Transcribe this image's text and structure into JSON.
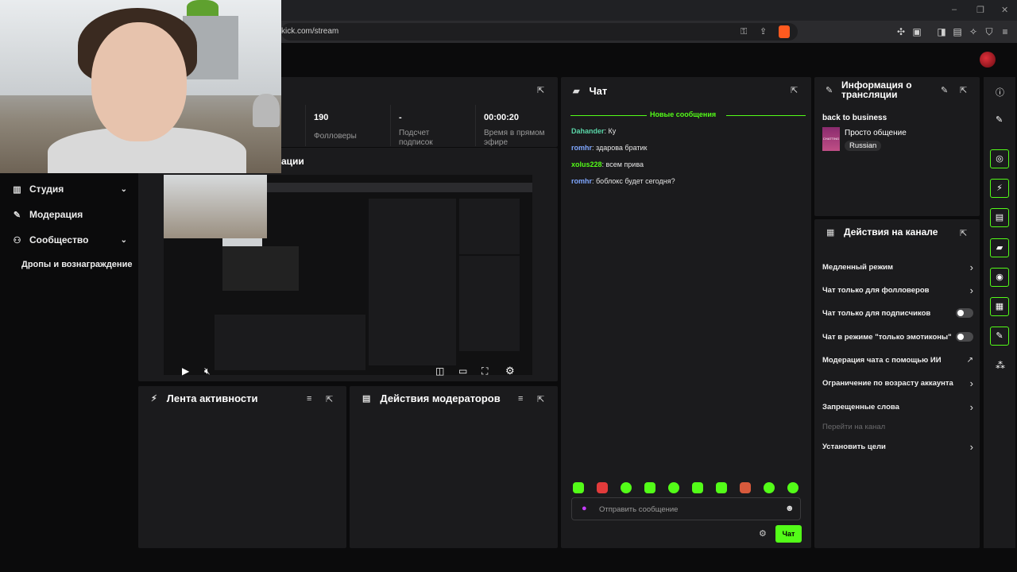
{
  "browser": {
    "url": "kick.com/stream",
    "win_minimize": "–",
    "win_restore": "❐",
    "win_close": "✕"
  },
  "stats": [
    {
      "value": "190",
      "label": "Фолловеры"
    },
    {
      "value": "-",
      "label": "Подсчет подписок"
    },
    {
      "value": "00:00:20",
      "label": "Время в прямом эфире"
    }
  ],
  "preview_heading_fragment": "ации",
  "nav": {
    "items": [
      {
        "label": "Студия",
        "icon": "studio-icon",
        "expandable": true
      },
      {
        "label": "Модерация",
        "icon": "wrench-icon",
        "expandable": false
      },
      {
        "label": "Сообщество",
        "icon": "community-icon",
        "expandable": true
      }
    ],
    "drops": "Дропы и вознаграждение"
  },
  "activity": {
    "title": "Лента активности"
  },
  "mod_actions": {
    "title": "Действия модераторов"
  },
  "chat": {
    "title": "Чат",
    "new_messages": "Новые сообщения",
    "messages": [
      {
        "user": "Dahander",
        "color": "#5ad6a8",
        "text": "Ку"
      },
      {
        "user": "romhr",
        "color": "#7fa7ff",
        "text": "здарова братик"
      },
      {
        "user": "xolus228",
        "color": "#53fc18",
        "text": "всем прива"
      },
      {
        "user": "romhr",
        "color": "#7fa7ff",
        "text": "боблокс будет сегодня?"
      }
    ],
    "input_placeholder": "Отправить сообщение",
    "send_label": "Чат"
  },
  "stream_info": {
    "title": "Информация о трансляции",
    "stream_title": "back to business",
    "category": "Просто общение",
    "language": "Russian",
    "thumb_text": "CHATTING"
  },
  "channel_actions": {
    "title": "Действия на канале",
    "rows": [
      {
        "label": "Медленный режим",
        "kind": "chevron"
      },
      {
        "label": "Чат только для фолловеров",
        "kind": "chevron"
      },
      {
        "label": "Чат только для подписчиков",
        "kind": "toggle"
      },
      {
        "label": "Чат в режиме \"только эмотиконы\"",
        "kind": "toggle"
      },
      {
        "label": "Модерация чата с помощью ИИ",
        "kind": "external"
      },
      {
        "label": "Ограничение по возрасту аккаунта",
        "kind": "chevron"
      },
      {
        "label": "Запрещенные слова",
        "kind": "chevron"
      },
      {
        "label": "Перейти на канал",
        "kind": "disabled"
      },
      {
        "label": "Установить цели",
        "kind": "chevron"
      }
    ]
  },
  "colors": {
    "accent": "#53fc18",
    "panel": "#1b1b1d",
    "background": "#0b0b0c"
  }
}
